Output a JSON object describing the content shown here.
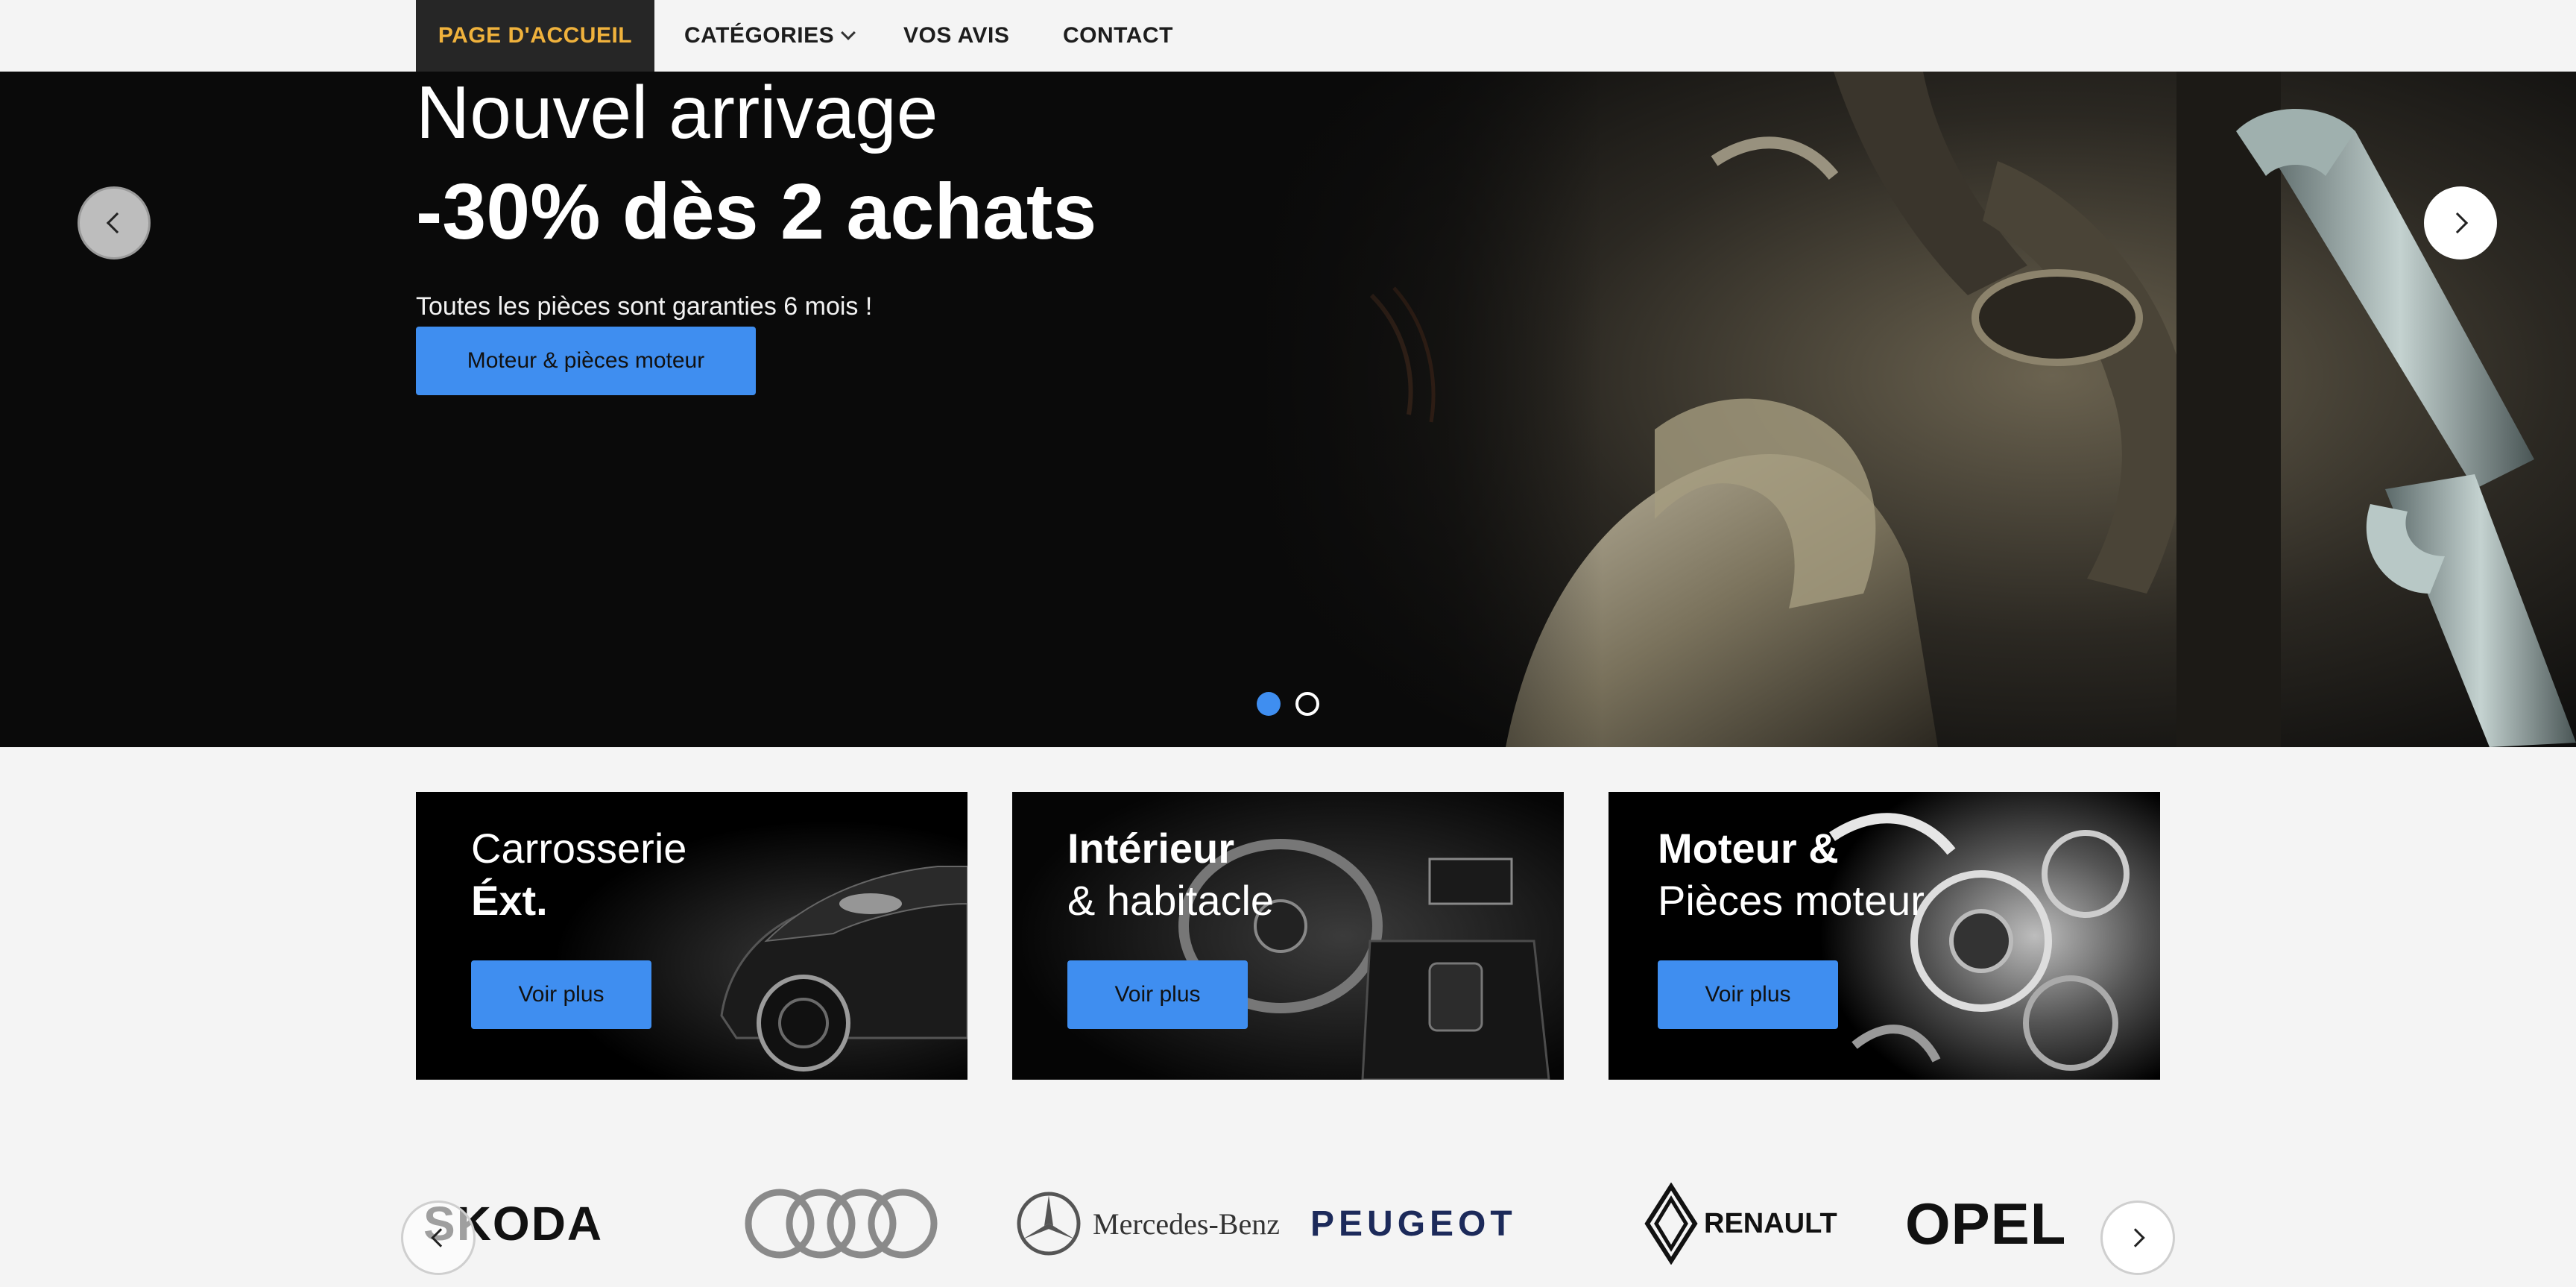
{
  "nav": {
    "items": [
      {
        "label": "PAGE D'ACCUEIL",
        "active": true
      },
      {
        "label": "CATÉGORIES",
        "has_dropdown": true
      },
      {
        "label": "VOS AVIS"
      },
      {
        "label": "CONTACT"
      }
    ],
    "active_color": "#f0b23c",
    "active_bg": "#262626"
  },
  "hero": {
    "title": "Nouvel arrivage",
    "promo": "-30% dès 2 achats",
    "subtitle": "Toutes les pièces sont garanties 6 mois !",
    "cta_label": "Moteur & pièces moteur",
    "prev_icon": "chevron-left-icon",
    "next_icon": "chevron-right-icon",
    "slides_total": 2,
    "active_slide": 1
  },
  "cards": [
    {
      "line1": "Carrosserie",
      "line2": "Éxt.",
      "button": "Voir plus"
    },
    {
      "line1": "Intérieur",
      "line2": "& habitacle",
      "button": "Voir plus"
    },
    {
      "line1": "Moteur &",
      "line2": "Pièces moteur",
      "button": "Voir plus"
    }
  ],
  "brands": {
    "items": [
      "SKODA",
      "Audi",
      "Mercedes-Benz",
      "PEUGEOT",
      "RENAULT",
      "OPEL"
    ]
  },
  "colors": {
    "accent": "#3f8ef0",
    "background": "#f4f4f4",
    "hero_bg": "#0a0a0a"
  }
}
